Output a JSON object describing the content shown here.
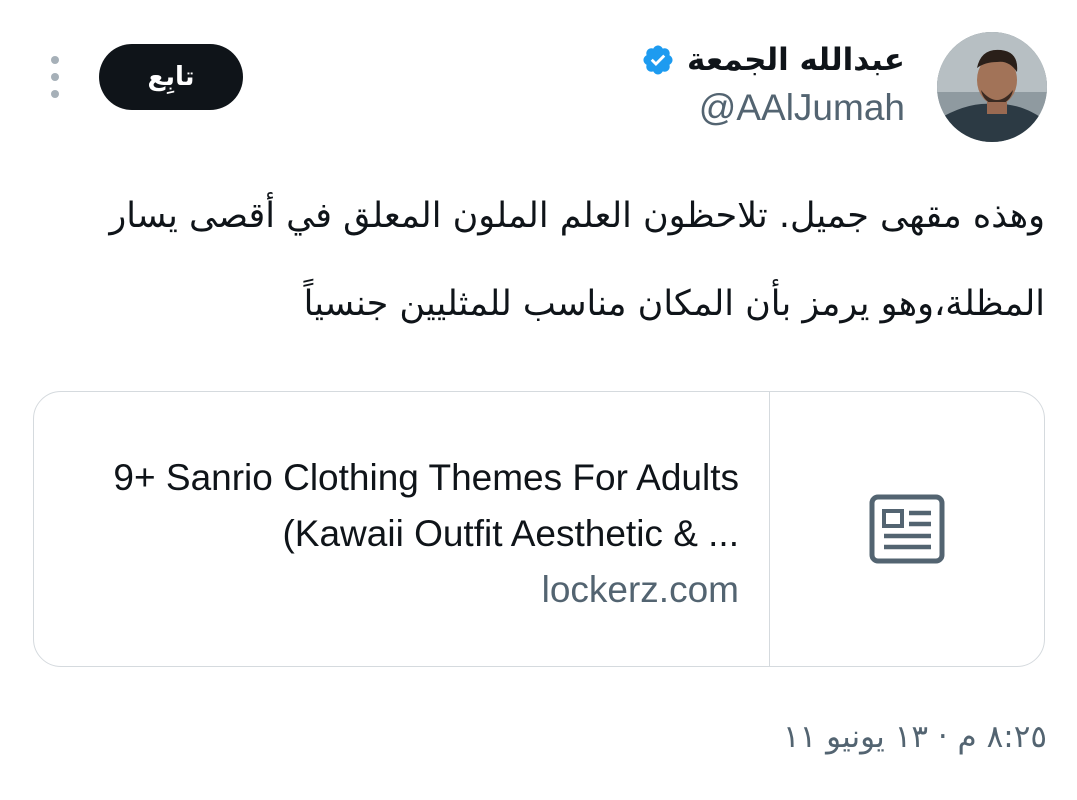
{
  "author": {
    "display_name": "عبدالله الجمعة",
    "handle": "@AAlJumah",
    "verified": true
  },
  "actions": {
    "follow_label": "تابِع"
  },
  "tweet": {
    "text": "وهذه مقهى جميل. تلاحظون العلم الملون المعلق في أقصى يسار المظلة،وهو يرمز بأن المكان مناسب للمثليين جنسياً"
  },
  "link_card": {
    "title": "9+ Sanrio Clothing Themes For Adults (Kawaii Outfit Aesthetic & ...",
    "domain": "lockerz.com",
    "thumbnail_icon": "article-icon"
  },
  "meta": {
    "timestamp": "٨:٢٥ م · ١٣ يونيو ١١"
  },
  "colors": {
    "text_primary": "#0f1419",
    "text_secondary": "#536471",
    "verified_blue": "#1d9bf0",
    "border": "#d5dade"
  }
}
